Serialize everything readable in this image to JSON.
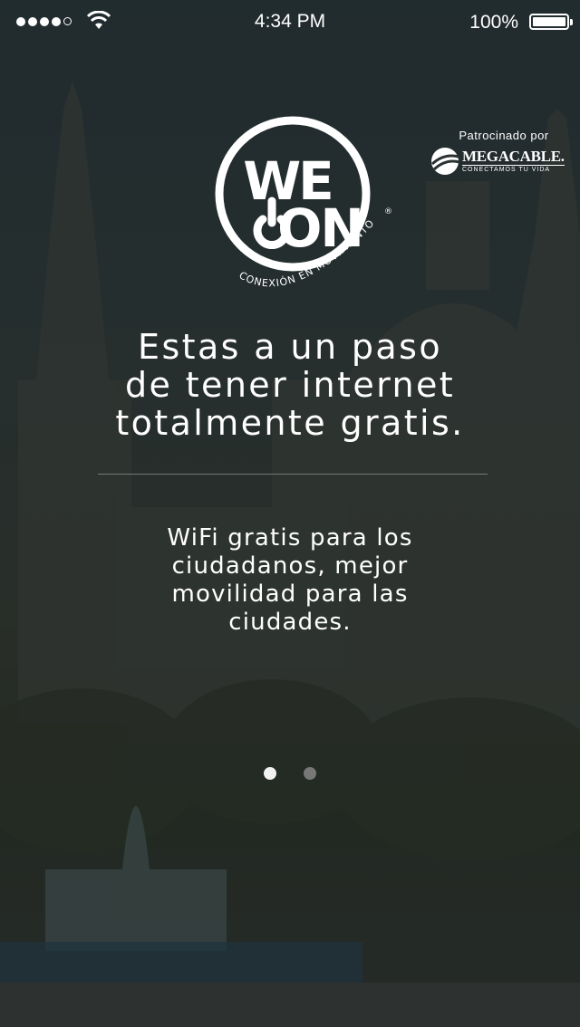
{
  "status_bar": {
    "signal_strength": "4 of 5",
    "time": "4:34 PM",
    "battery_percent": "100%"
  },
  "logo": {
    "word_top": "WE",
    "word_bottom": "ON",
    "tagline": "CONEXIÓN EN MOVIMIENTO",
    "registered": "®"
  },
  "sponsor": {
    "label": "Patrocinado por",
    "name": "MEGACABLE.",
    "tagline": "CONECTAMOS TU VIDA"
  },
  "headline": {
    "line1": "Estas a un paso",
    "line2": "de tener internet",
    "line3": "totalmente gratis."
  },
  "subline": {
    "line1": "WiFi gratis para los",
    "line2": "ciudadanos, mejor",
    "line3": "movilidad para las",
    "line4": "ciudades."
  },
  "pager": {
    "current_page": 1,
    "total_pages": 2
  },
  "colors": {
    "overlay": "#2b3131",
    "text": "#ffffff",
    "dot_active": "#f2f2f2",
    "dot_inactive": "#777777"
  },
  "icons": [
    "wifi-icon",
    "battery-icon",
    "weon-power-icon",
    "megacable-logo-icon"
  ]
}
